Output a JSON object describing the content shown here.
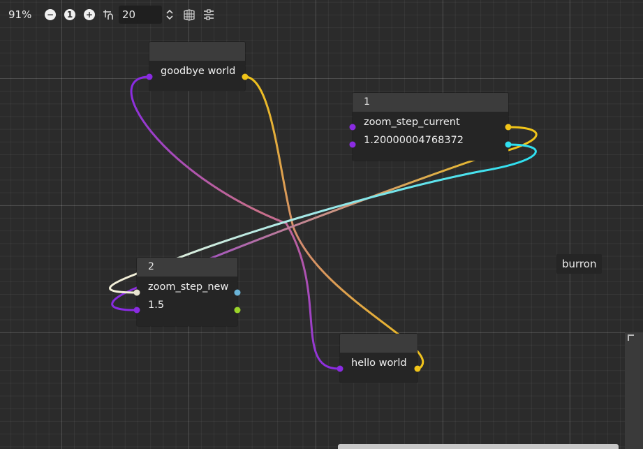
{
  "toolbar": {
    "zoom": "91%",
    "zoom_reset_label": "1",
    "snap_value": "20"
  },
  "nodes": {
    "goodbye": {
      "title": "",
      "row_label": "goodbye world"
    },
    "n1": {
      "title": "1",
      "rows": [
        "zoom_step_current",
        "1.20000004768372"
      ]
    },
    "n2": {
      "title": "2",
      "rows": [
        "zoom_step_new",
        "1.5"
      ]
    },
    "hello": {
      "title": "",
      "row_label": "hello world"
    }
  },
  "burron_label": "burron",
  "colors": {
    "purple_port": "#8a2be2",
    "yellow_port": "#f0c419",
    "cyan_port": "#30e0f0",
    "white_port": "#e8e4d0",
    "blue_port": "#6ab4d8",
    "green_port": "#9bd52a"
  },
  "icons": [
    "zoom-out-icon",
    "zoom-reset-icon",
    "zoom-in-icon",
    "snap-grid-icon",
    "spinner-icon",
    "grid-toggle-icon",
    "minimap-icon"
  ]
}
